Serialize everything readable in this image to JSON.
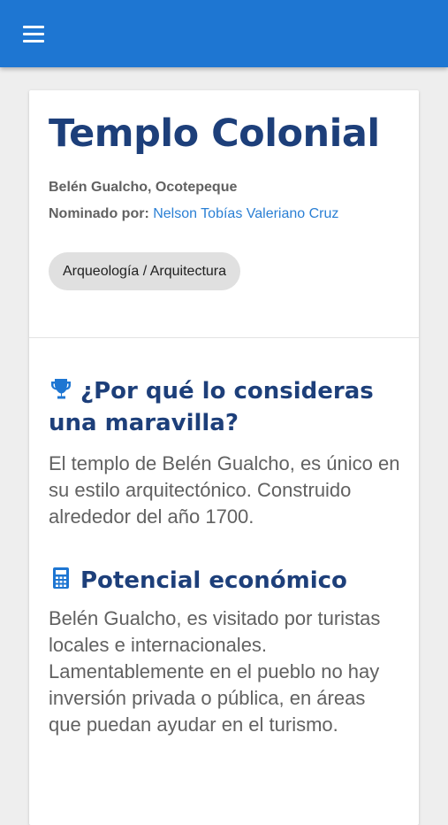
{
  "appbar": {
    "menu_icon": "hamburger-menu-icon",
    "color": "#1e76d2"
  },
  "entry": {
    "title": "Templo Colonial",
    "location": "Belén Gualcho, Ocotepeque",
    "nominee_label": "Nominado por:",
    "nominee_name": "Nelson Tobías Valeriano Cruz",
    "category": "Arqueología / Arquitectura"
  },
  "sections": [
    {
      "icon": "trophy-icon",
      "title": "¿Por qué lo consideras una maravilla?",
      "body": "El templo de Belén Gualcho, es único en su estilo arquitectónico. Construido alrededor del año 1700."
    },
    {
      "icon": "calculator-icon",
      "title": "Potencial económico",
      "body": "Belén Gualcho, es visitado por turistas locales e internacionales. Lamentablemente en el pueblo no hay inversión privada o pública, en áreas que puedan ayudar en el turismo."
    }
  ],
  "colors": {
    "heading": "#1d3f7a",
    "link": "#2a7fd4",
    "text": "#616161"
  }
}
